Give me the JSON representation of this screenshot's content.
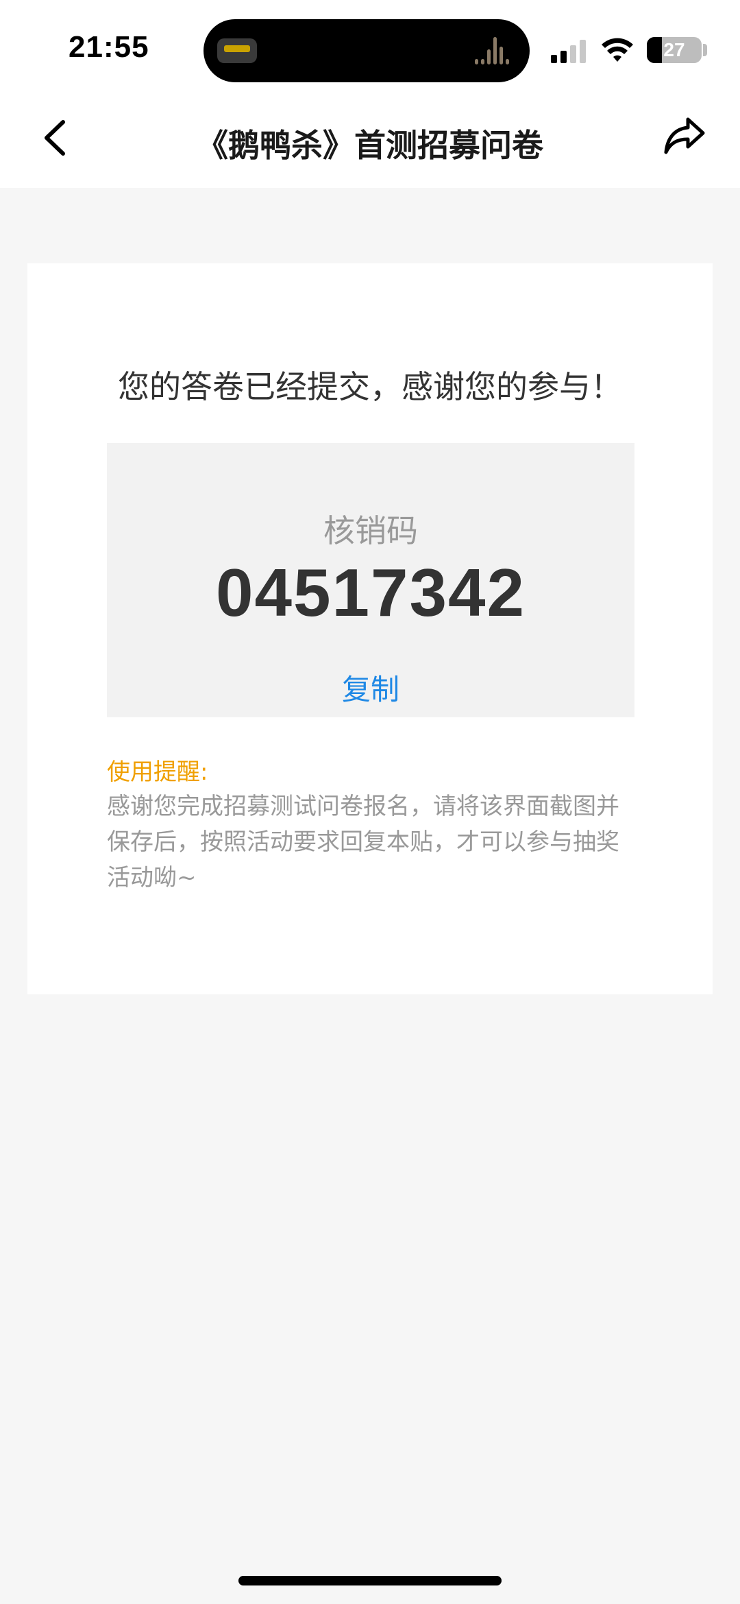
{
  "status_bar": {
    "time": "21:55",
    "battery_level": "27",
    "icons": [
      "cellular-signal-icon",
      "wifi-icon",
      "battery-icon"
    ]
  },
  "nav": {
    "title": "《鹅鸭杀》首测招募问卷",
    "back_icon": "chevron-left-icon",
    "share_icon": "share-arrow-icon"
  },
  "result": {
    "message": "您的答卷已经提交，感谢您的参与！",
    "code_label": "核销码",
    "code_value": "04517342",
    "copy_label": "复制"
  },
  "notice": {
    "title": "使用提醒:",
    "text": "感谢您完成招募测试问卷报名，请将该界面截图并保存后，按照活动要求回复本贴，才可以参与抽奖活动呦~"
  },
  "colors": {
    "background": "#f6f6f6",
    "card": "#ffffff",
    "code_box": "#f2f2f2",
    "link_blue": "#1e88e5",
    "notice_orange": "#f0a000",
    "muted_text": "#999999"
  }
}
